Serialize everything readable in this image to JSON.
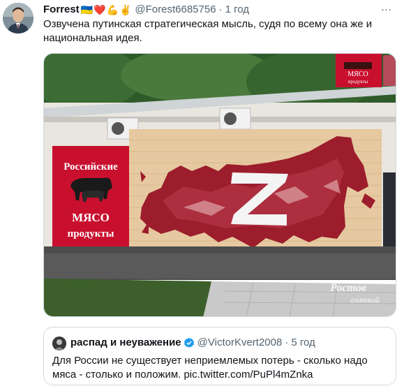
{
  "tweet": {
    "author_name": "Forrest",
    "author_emojis": "🇺🇦❤️💪✌️",
    "handle": "@Forest6685756",
    "separator": "·",
    "time": "1 год",
    "more_icon": "…",
    "text": "Озвучена путинская стратегическая мысль, судя по всему она же и национальная идея."
  },
  "photo": {
    "sign_left_line1": "Российские",
    "sign_left_line2": "МЯСО",
    "sign_left_line3": "продукты",
    "sign_top_line1": "МЯСО",
    "sign_top_line2": "продукты",
    "mural_letter": "Z",
    "watermark_line1": "Ростов",
    "watermark_line2": "главный"
  },
  "quote": {
    "author_name": "распад и неуважение",
    "handle": "@VictorKvert2008",
    "separator": "·",
    "time": "5 год",
    "text": "Для России не существует неприемлемых потерь - сколько надо мяса - столько и положим. pic.twitter.com/PuPl4mZnka"
  },
  "colors": {
    "text_primary": "#0f1419",
    "text_secondary": "#536471",
    "border": "#cfd9de",
    "verified": "#1d9bf0",
    "sign_red": "#c8102e"
  }
}
